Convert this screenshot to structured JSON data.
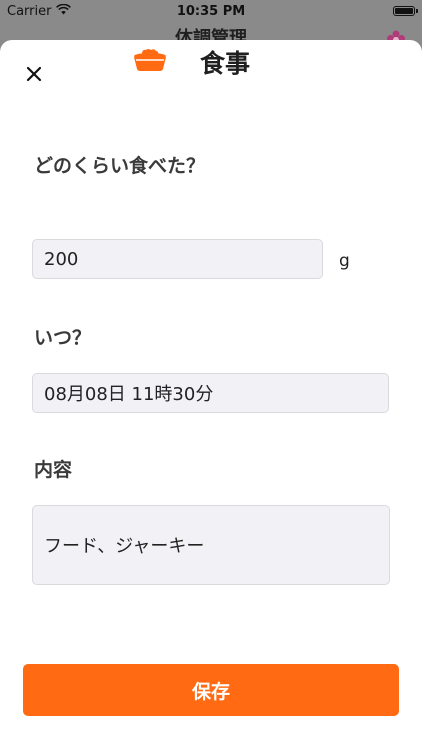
{
  "status_bar": {
    "carrier": "Carrier",
    "time": "10:35 PM"
  },
  "background": {
    "header_title": "体調管理"
  },
  "sheet": {
    "title": "食事",
    "icons": {
      "close": "close-icon",
      "bowl": "pet-food-bowl-icon",
      "background_flower": "flower-icon"
    },
    "accent_color": "#ff6a13",
    "amount": {
      "label": "どのくらい食べた？",
      "value": "200",
      "unit": "g"
    },
    "when": {
      "label": "いつ？",
      "value": "08月08日 11時30分"
    },
    "content": {
      "label": "内容",
      "value": "フード、ジャーキー"
    },
    "save_label": "保存"
  }
}
